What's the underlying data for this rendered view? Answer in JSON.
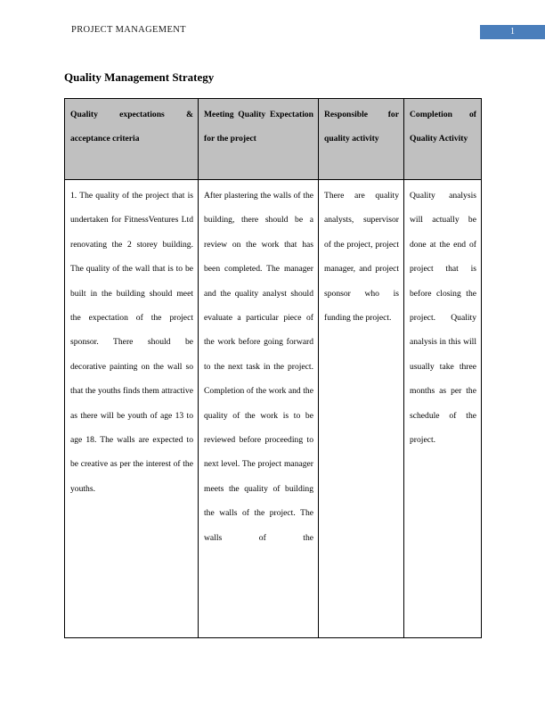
{
  "header": {
    "running_title": "PROJECT MANAGEMENT",
    "page_number": "1",
    "badge_color": "#4a7ebb"
  },
  "document": {
    "title": "Quality Management Strategy"
  },
  "table": {
    "header_background": "#c0c0c0",
    "columns": [
      "Quality expectations & acceptance criteria",
      "Meeting Quality Expectation for the project",
      "Responsible for quality activity",
      "Completion of Quality Activity"
    ],
    "rows": [
      {
        "cells": [
          "1. The quality of the project that is undertaken for FitnessVentures Ltd renovating the 2 storey building. The quality of the wall that is to be built in the building should meet the expectation of the project sponsor. There should be decorative painting on the wall so that the youths finds them attractive as there will be youth of age 13 to age 18. The walls are expected to be creative as per the interest of the youths.",
          "After plastering the walls of the building, there should be a review on the work that has been completed. The manager and the quality analyst should evaluate a particular piece of the work before going forward to the next task in the project. Completion of the work and the quality of the work is to be reviewed before proceeding to next level. The project manager meets the quality of building the walls of the project. The walls of the",
          "There are quality analysts, supervisor of the project, project manager, and project sponsor who is funding the project.",
          "Quality analysis will actually be done at the end of project that is before closing the project. Quality analysis in this will usually take three months as per the schedule of the project."
        ]
      }
    ]
  }
}
